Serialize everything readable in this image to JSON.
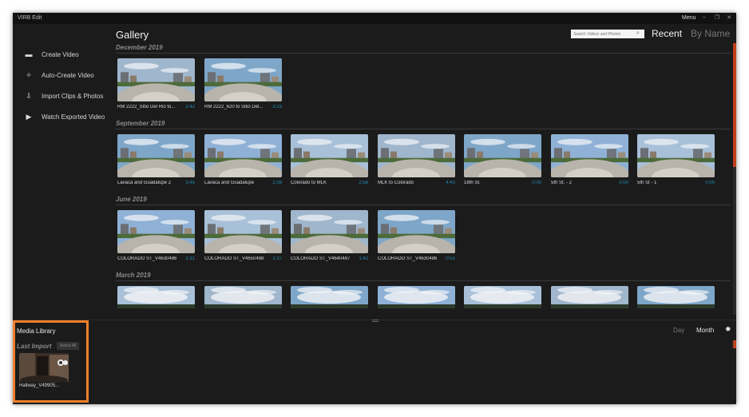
{
  "app": {
    "title": "VIRB Edit",
    "menu_label": "Menu",
    "min_glyph": "–",
    "max_glyph": "❐",
    "close_glyph": "✕"
  },
  "sidebar": {
    "items": [
      {
        "label": "Create Video",
        "icon": "film-icon",
        "glyph": "▬"
      },
      {
        "label": "Auto-Create Video",
        "icon": "magic-wand-icon",
        "glyph": "✧"
      },
      {
        "label": "Import Clips & Photos",
        "icon": "import-icon",
        "glyph": "⇩"
      },
      {
        "label": "Watch Exported Video",
        "icon": "play-icon",
        "glyph": "▶"
      }
    ]
  },
  "gallery": {
    "title": "Gallery",
    "search_placeholder": "Search Videos and Photos",
    "sort_recent": "Recent",
    "sort_name": "By Name",
    "sections": [
      {
        "label": "December 2019",
        "items": [
          {
            "name": "RM 2222_Sitio Del Rio to...",
            "duration": "2:42"
          },
          {
            "name": "RM 2222_620 to Sitio Del...",
            "duration": "3:23"
          }
        ]
      },
      {
        "label": "September 2019",
        "items": [
          {
            "name": "Lavaca and Guadalupe 2",
            "duration": "3:45"
          },
          {
            "name": "Lavaca and Guadalupe",
            "duration": "2:08"
          },
          {
            "name": "Colorado to MLK",
            "duration": "2:56"
          },
          {
            "name": "MLK to Colorado",
            "duration": "4:43"
          },
          {
            "name": "18th St.",
            "duration": "0:00"
          },
          {
            "name": "5th St. - 2",
            "duration": "0:00"
          },
          {
            "name": "5th St - 1",
            "duration": "0:00"
          }
        ]
      },
      {
        "label": "June 2019",
        "items": [
          {
            "name": "COLORADO ST_V4630486",
            "duration": "1:31"
          },
          {
            "name": "COLORADO ST_V4650488",
            "duration": "1:37"
          },
          {
            "name": "COLORADO ST_V4640487",
            "duration": "1:42"
          },
          {
            "name": "COLORADO ST_V4630486",
            "duration": "0:51"
          }
        ]
      },
      {
        "label": "March 2019",
        "items": [
          {},
          {},
          {},
          {},
          {},
          {},
          {}
        ]
      }
    ]
  },
  "media_library": {
    "title": "Media Library",
    "last_import": "Last Import",
    "select_all": "Select All",
    "item_name": "Hallway_V49905...",
    "day": "Day",
    "month": "Month",
    "gear_glyph": "✹"
  },
  "colors": {
    "accent": "#c0401a",
    "duration": "#1f8fb8",
    "highlight": "#f07f2a"
  }
}
